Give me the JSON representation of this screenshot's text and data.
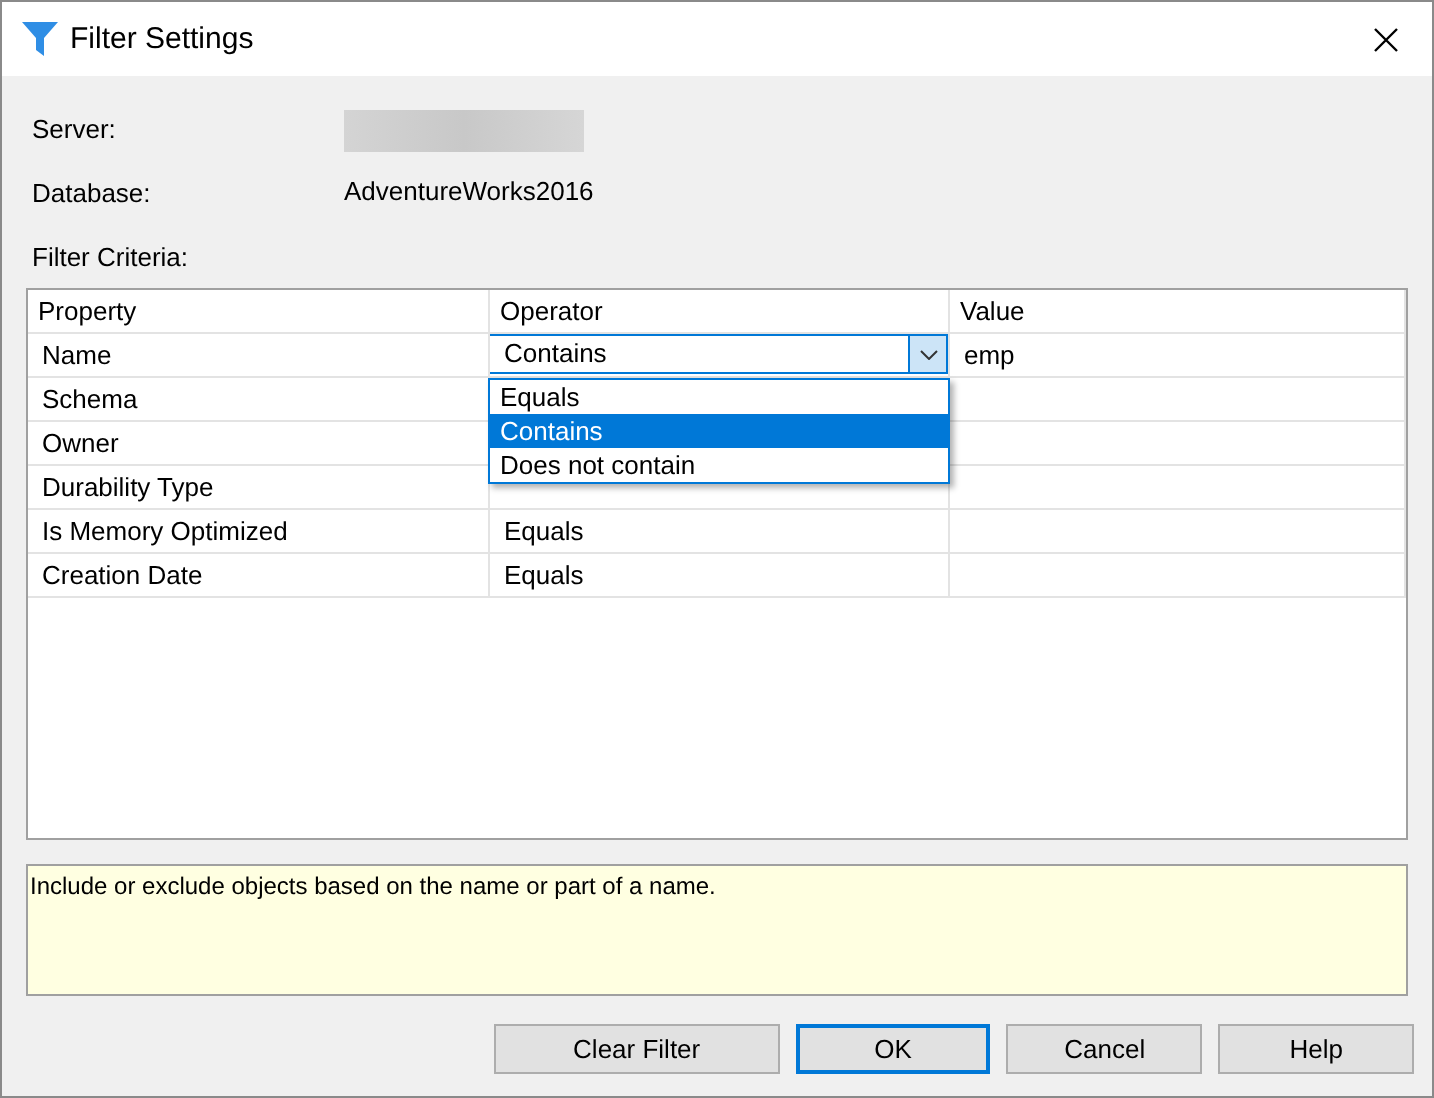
{
  "window": {
    "title": "Filter Settings"
  },
  "info": [
    {
      "label": "Server:",
      "kind": "redacted"
    },
    {
      "label": "Database:",
      "kind": "text",
      "value": "AdventureWorks2016"
    },
    {
      "label": "Filter Criteria:",
      "kind": "none"
    }
  ],
  "grid": {
    "columns": [
      "Property",
      "Operator",
      "Value"
    ],
    "rows": [
      {
        "property": "Name",
        "operator": "Contains",
        "value": "emp",
        "kind": "combo"
      },
      {
        "property": "Schema",
        "kind": "plain"
      },
      {
        "property": "Owner",
        "kind": "plain"
      },
      {
        "property": "Durability Type",
        "kind": "plain"
      },
      {
        "property": "Is Memory Optimized",
        "operator": "Equals",
        "kind": "plain"
      },
      {
        "property": "Creation Date",
        "operator": "Equals",
        "kind": "plain"
      }
    ],
    "dropdown": [
      {
        "label": "Equals",
        "selected": false
      },
      {
        "label": "Contains",
        "selected": true
      },
      {
        "label": "Does not contain",
        "selected": false
      }
    ]
  },
  "description": "Include or exclude objects based on the name or part of a name.",
  "buttons": [
    {
      "label": "Clear Filter",
      "default": false
    },
    {
      "label": "OK",
      "default": true
    },
    {
      "label": "Cancel",
      "default": false
    },
    {
      "label": "Help",
      "default": false
    }
  ]
}
